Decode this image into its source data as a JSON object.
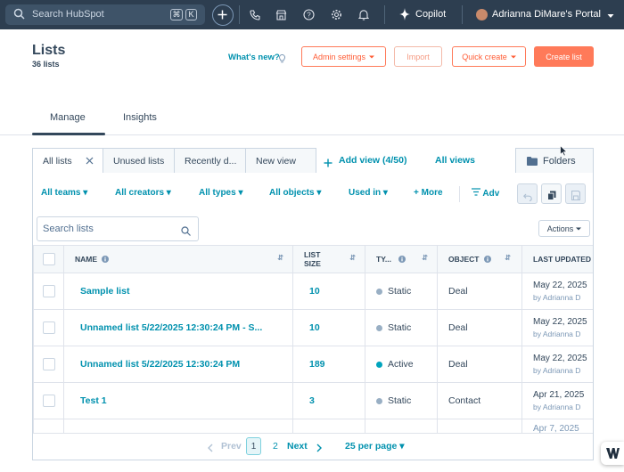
{
  "topnav": {
    "search_placeholder": "Search HubSpot",
    "shortcut_keys": [
      "⌘",
      "K"
    ],
    "copilot_label": "Copilot",
    "portal_label": "Adrianna DiMare's Portal"
  },
  "header": {
    "title": "Lists",
    "subtitle": "36 lists",
    "whats_new": "What's new?",
    "admin_settings": "Admin settings",
    "import": "Import",
    "quick_create": "Quick create",
    "create_list": "Create list"
  },
  "tabs": [
    "Manage",
    "Insights"
  ],
  "views": {
    "tabs": [
      "All lists",
      "Unused lists",
      "Recently d...",
      "New view"
    ],
    "add_view": "Add view (4/50)",
    "all_views": "All views",
    "folders": "Folders"
  },
  "filters": [
    "All teams",
    "All creators",
    "All types",
    "All objects",
    "Used in",
    "More",
    "Adv"
  ],
  "search_lists_placeholder": "Search lists",
  "actions_label": "Actions",
  "table": {
    "columns": [
      "NAME",
      "LIST SIZE",
      "TY...",
      "OBJECT",
      "LAST UPDATED"
    ],
    "list_size_lines": [
      "LIST",
      "SIZE"
    ],
    "rows": [
      {
        "name": "Sample list",
        "size": "10",
        "type": "Static",
        "object": "Deal",
        "updated": "May 22, 2025",
        "by": "by Adrianna D"
      },
      {
        "name": "Unnamed list 5/22/2025 12:30:24 PM - S...",
        "size": "10",
        "type": "Static",
        "object": "Deal",
        "updated": "May 22, 2025",
        "by": "by Adrianna D"
      },
      {
        "name": "Unnamed list 5/22/2025 12:30:24 PM",
        "size": "189",
        "type": "Active",
        "object": "Deal",
        "updated": "May 22, 2025",
        "by": "by Adrianna D"
      },
      {
        "name": "Test 1",
        "size": "3",
        "type": "Static",
        "object": "Contact",
        "updated": "Apr 21, 2025",
        "by": "by Adrianna D"
      },
      {
        "name": "",
        "size": "",
        "type": "",
        "object": "",
        "updated": "Apr 7, 2025",
        "by": ""
      }
    ]
  },
  "pagination": {
    "prev": "Prev",
    "pages": [
      "1",
      "2"
    ],
    "next": "Next",
    "per_page": "25 per page"
  },
  "colors": {
    "nav_bg": "#2d3e50",
    "link": "#0091ae",
    "accent": "#ff7a59",
    "static_dot": "#99afc4",
    "active_dot": "#00a4bd"
  }
}
